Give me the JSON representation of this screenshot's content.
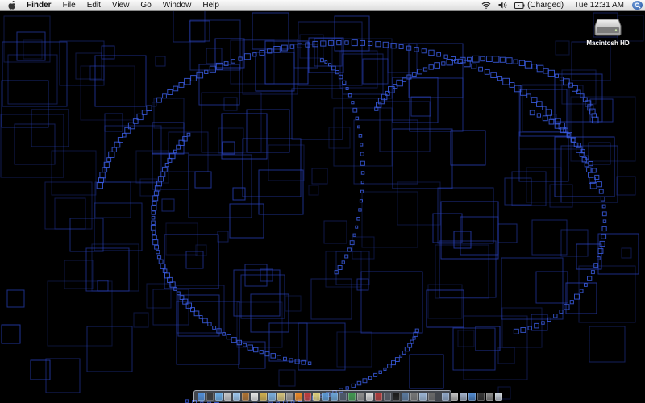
{
  "menubar": {
    "app_name": "Finder",
    "menus": [
      "File",
      "Edit",
      "View",
      "Go",
      "Window",
      "Help"
    ],
    "battery_status": "(Charged)",
    "clock": "Tue 12:31 AM"
  },
  "desktop": {
    "icons": [
      {
        "label": "Macintosh HD",
        "icon": "hard-drive-icon"
      }
    ]
  },
  "dock": {
    "items": [
      {
        "name": "finder",
        "color": "#4f8fdc"
      },
      {
        "name": "dashboard",
        "color": "#3a3a3a"
      },
      {
        "name": "safari",
        "color": "#6aaee8"
      },
      {
        "name": "mail",
        "color": "#c9c9c9"
      },
      {
        "name": "ichat",
        "color": "#9ec8f0"
      },
      {
        "name": "address-book",
        "color": "#b0722e"
      },
      {
        "name": "ical",
        "color": "#e8e8e8"
      },
      {
        "name": "preview",
        "color": "#d4b24c"
      },
      {
        "name": "itunes",
        "color": "#7ab0e0"
      },
      {
        "name": "iphoto",
        "color": "#d7c47a"
      },
      {
        "name": "system-preferences",
        "color": "#9a9a9a"
      },
      {
        "name": "vlc",
        "color": "#f08a24"
      },
      {
        "name": "app-13",
        "color": "#c43c3c"
      },
      {
        "name": "app-14",
        "color": "#e2d27a"
      },
      {
        "name": "app-15",
        "color": "#5a9ad6"
      },
      {
        "name": "app-16",
        "color": "#6ba6d8"
      },
      {
        "name": "app-17",
        "color": "#4e5a6c"
      },
      {
        "name": "app-18",
        "color": "#3f9a4f"
      },
      {
        "name": "app-19",
        "color": "#8e8e8e"
      },
      {
        "name": "app-20",
        "color": "#d8d8d8"
      },
      {
        "name": "app-21",
        "color": "#b23a3a"
      },
      {
        "name": "app-22",
        "color": "#555b66"
      },
      {
        "name": "terminal",
        "color": "#1a1a1a"
      },
      {
        "name": "app-24",
        "color": "#5a7aa0"
      },
      {
        "name": "app-25",
        "color": "#777777"
      },
      {
        "name": "app-26",
        "color": "#9db8d8"
      },
      {
        "name": "app-27",
        "color": "#6a6a6a"
      }
    ],
    "right_items": [
      {
        "name": "applications-stack",
        "color": "#8fa7c8"
      },
      {
        "name": "documents-stack",
        "color": "#c8c8c8"
      },
      {
        "name": "downloads-stack",
        "color": "#a8b8d0"
      },
      {
        "name": "app-31",
        "color": "#5590d8"
      },
      {
        "name": "app-32",
        "color": "#3a3a3a"
      },
      {
        "name": "app-33",
        "color": "#909090"
      },
      {
        "name": "trash",
        "color": "#d0d8e0"
      }
    ]
  },
  "theme": {
    "wallpaper_line": "#2b45c8",
    "wallpaper_bg": "#000000"
  }
}
